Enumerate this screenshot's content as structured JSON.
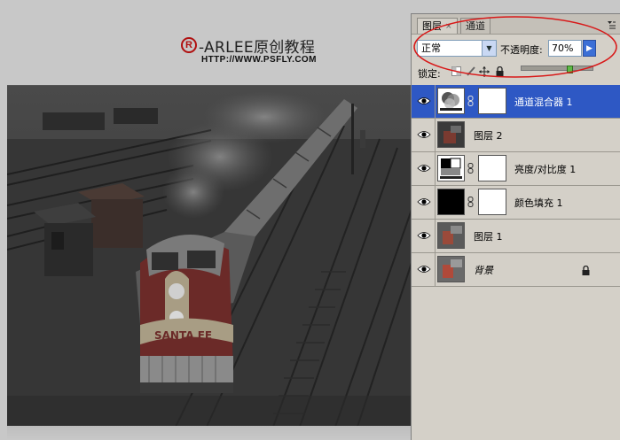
{
  "watermark": {
    "reg_symbol": "R",
    "title": "-ARLEE原创教程",
    "url": "HTTP://WWW.PSFLY.COM"
  },
  "layers_panel": {
    "tabs": [
      {
        "label": "图层",
        "close": "×",
        "active": true
      },
      {
        "label": "通道",
        "active": false
      }
    ],
    "menu_icon": "panel-menu-icon",
    "blend_mode": "正常",
    "opacity_label": "不透明度:",
    "opacity_value": "70%",
    "lock_label": "锁定:",
    "fill_level_percent": 70,
    "layers": [
      {
        "name": "通道混合器 1",
        "visible": true,
        "selected": true,
        "type": "channel-mixer-adjustment",
        "has_mask": true
      },
      {
        "name": "图层 2",
        "visible": true,
        "selected": false,
        "type": "pixel"
      },
      {
        "name": "亮度/对比度 1",
        "visible": true,
        "selected": false,
        "type": "brightness-contrast-adjustment",
        "has_mask": true
      },
      {
        "name": "颜色填充 1",
        "visible": true,
        "selected": false,
        "type": "solid-color-fill",
        "has_mask": true
      },
      {
        "name": "图层 1",
        "visible": true,
        "selected": false,
        "type": "pixel"
      },
      {
        "name": "背景",
        "visible": true,
        "selected": false,
        "type": "background",
        "locked": true
      }
    ]
  },
  "colors": {
    "canvas_bg": "#c8c8c8",
    "panel_bg": "#d4d0c8",
    "selection": "#2e58c4",
    "annotation_red": "#d81818",
    "logo_red": "#b01010"
  }
}
